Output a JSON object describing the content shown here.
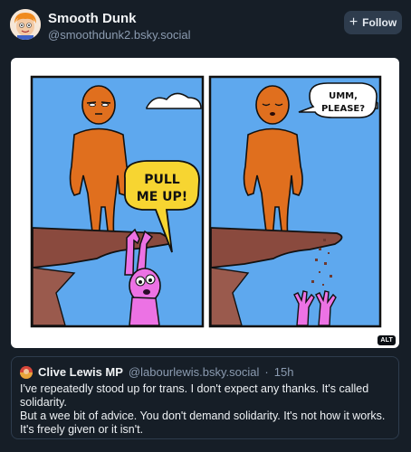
{
  "post": {
    "author_name": "Smooth Dunk",
    "author_handle": "@smoothdunk2.bsky.social",
    "follow_label": "Follow"
  },
  "image": {
    "alt_badge": "ALT",
    "panel1_bubble_line1": "PULL",
    "panel1_bubble_line2": "ME UP!",
    "panel2_bubble_line1": "UMM,",
    "panel2_bubble_line2": "PLEASE?"
  },
  "quote": {
    "author_name": "Clive Lewis MP",
    "author_handle": "@labourlewis.bsky.social",
    "separator": "·",
    "time": "15h",
    "paragraphs": [
      "I've repeatedly stood up for trans. I don't expect any thanks. It's called solidarity.",
      "But a wee bit of advice. You don't demand solidarity. It's not how it works. It's freely given or it isn't."
    ]
  },
  "colors": {
    "background": "#161e27",
    "sky": "#5ea8ee",
    "figure_orange": "#e06f1e",
    "figure_pink": "#ec72e4",
    "cliff": "#8a4a3e",
    "bubble": "#f7d531"
  }
}
